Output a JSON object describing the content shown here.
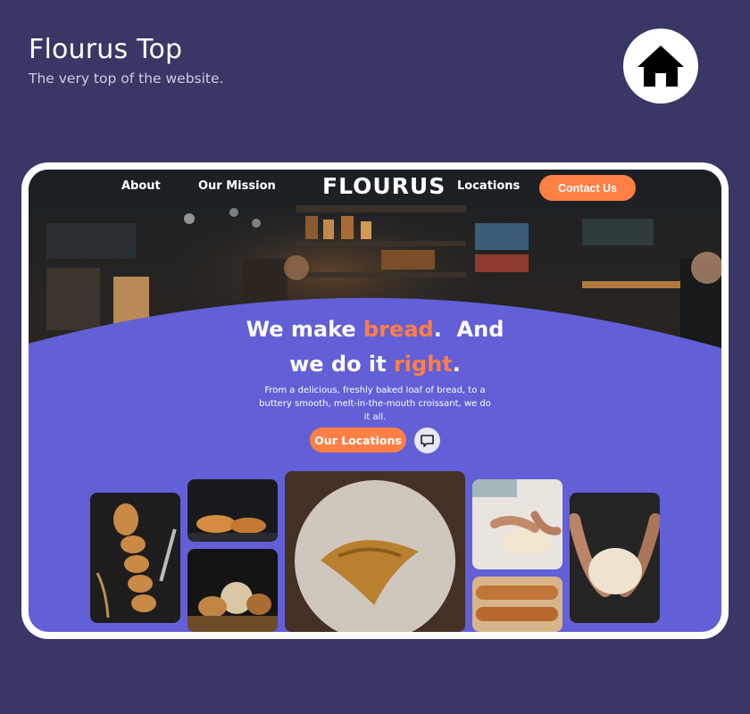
{
  "page": {
    "title": "Flourus Top",
    "subtitle": "The very top of the website."
  },
  "icons": {
    "home": "home-icon",
    "chat": "chat-bubble-icon"
  },
  "site": {
    "nav": {
      "about": "About",
      "mission": "Our Mission",
      "brand": "FLOURUS",
      "locations": "Locations",
      "contact": "Contact Us"
    },
    "hero": {
      "line1_a": "We make ",
      "line1_accent": "bread",
      "line1_b": ".  And",
      "line2_a": "we do it ",
      "line2_accent": "right",
      "line2_b": ".",
      "body": "From a delicious, freshly baked loaf of bread, to a buttery smooth, melt-in-the-mouth croissant, we do it all.",
      "cta": "Our Locations"
    }
  },
  "colors": {
    "background": "#393766",
    "hero_purple": "#625fd7",
    "accent_orange": "#ff7f45",
    "white": "#ffffff"
  }
}
